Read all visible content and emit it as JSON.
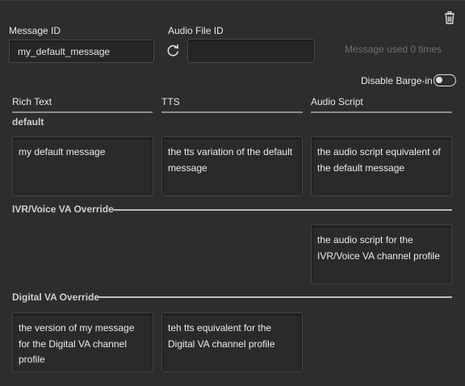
{
  "header": {
    "message_id_label": "Message ID",
    "message_id_value": "my_default_message",
    "audio_file_id_label": "Audio File ID",
    "audio_file_id_value": "",
    "usage_text": "Message used 0 times",
    "disable_barge_in_label": "Disable Barge-in",
    "disable_barge_in_on": false
  },
  "columns": [
    "Rich Text",
    "TTS",
    "Audio Script"
  ],
  "groups": {
    "default": {
      "title": "default",
      "rich_text": "my default message",
      "tts": "the tts variation of the default message",
      "audio_script": "the audio script equivalent of the default message"
    },
    "ivr": {
      "title": "IVR/Voice VA Override",
      "audio_script": "the audio script for the IVR/Voice VA channel profile"
    },
    "digital": {
      "title": "Digital VA Override",
      "rich_text": "the version of my message for the Digital VA channel profile",
      "tts": "teh tts equivalent for the Digital VA channel profile"
    }
  },
  "icons": {
    "delete": "trash-icon",
    "refresh": "refresh-icon"
  }
}
